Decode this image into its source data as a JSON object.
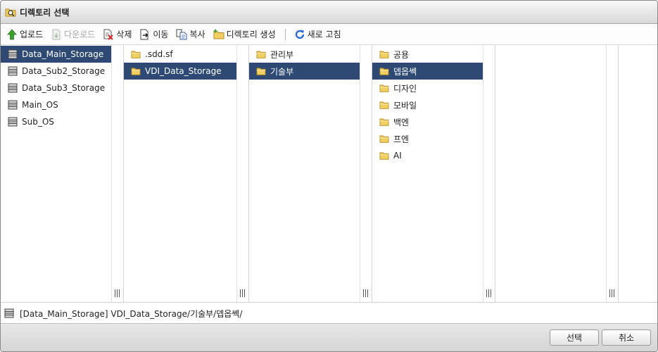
{
  "window": {
    "title": "디렉토리 선택"
  },
  "toolbar": {
    "upload": "업로드",
    "download": "다운로드",
    "delete": "삭제",
    "move": "이동",
    "copy": "복사",
    "create_dir": "디렉토리 생성",
    "refresh": "새로 고침"
  },
  "columns": {
    "storages": [
      "Data_Main_Storage",
      "Data_Sub2_Storage",
      "Data_Sub3_Storage",
      "Main_OS",
      "Sub_OS"
    ],
    "level1": [
      ".sdd.sf",
      "VDI_Data_Storage"
    ],
    "level2": [
      "관리부",
      "기술부"
    ],
    "level3": [
      "공용",
      "뎁옵쎅",
      "디자인",
      "모바일",
      "백엔",
      "프엔",
      "AI"
    ]
  },
  "selected": {
    "storage": 0,
    "level1": 1,
    "level2": 1,
    "level3": 1
  },
  "path": "[Data_Main_Storage] VDI_Data_Storage/기술부/뎁옵쎅/",
  "buttons": {
    "ok": "선택",
    "cancel": "취소"
  },
  "colors": {
    "selection": "#2e4a74",
    "folder": "#f2cf63",
    "upload_arrow": "#3aa12c",
    "refresh": "#2d6ad1",
    "delete_x": "#d62a2a"
  }
}
